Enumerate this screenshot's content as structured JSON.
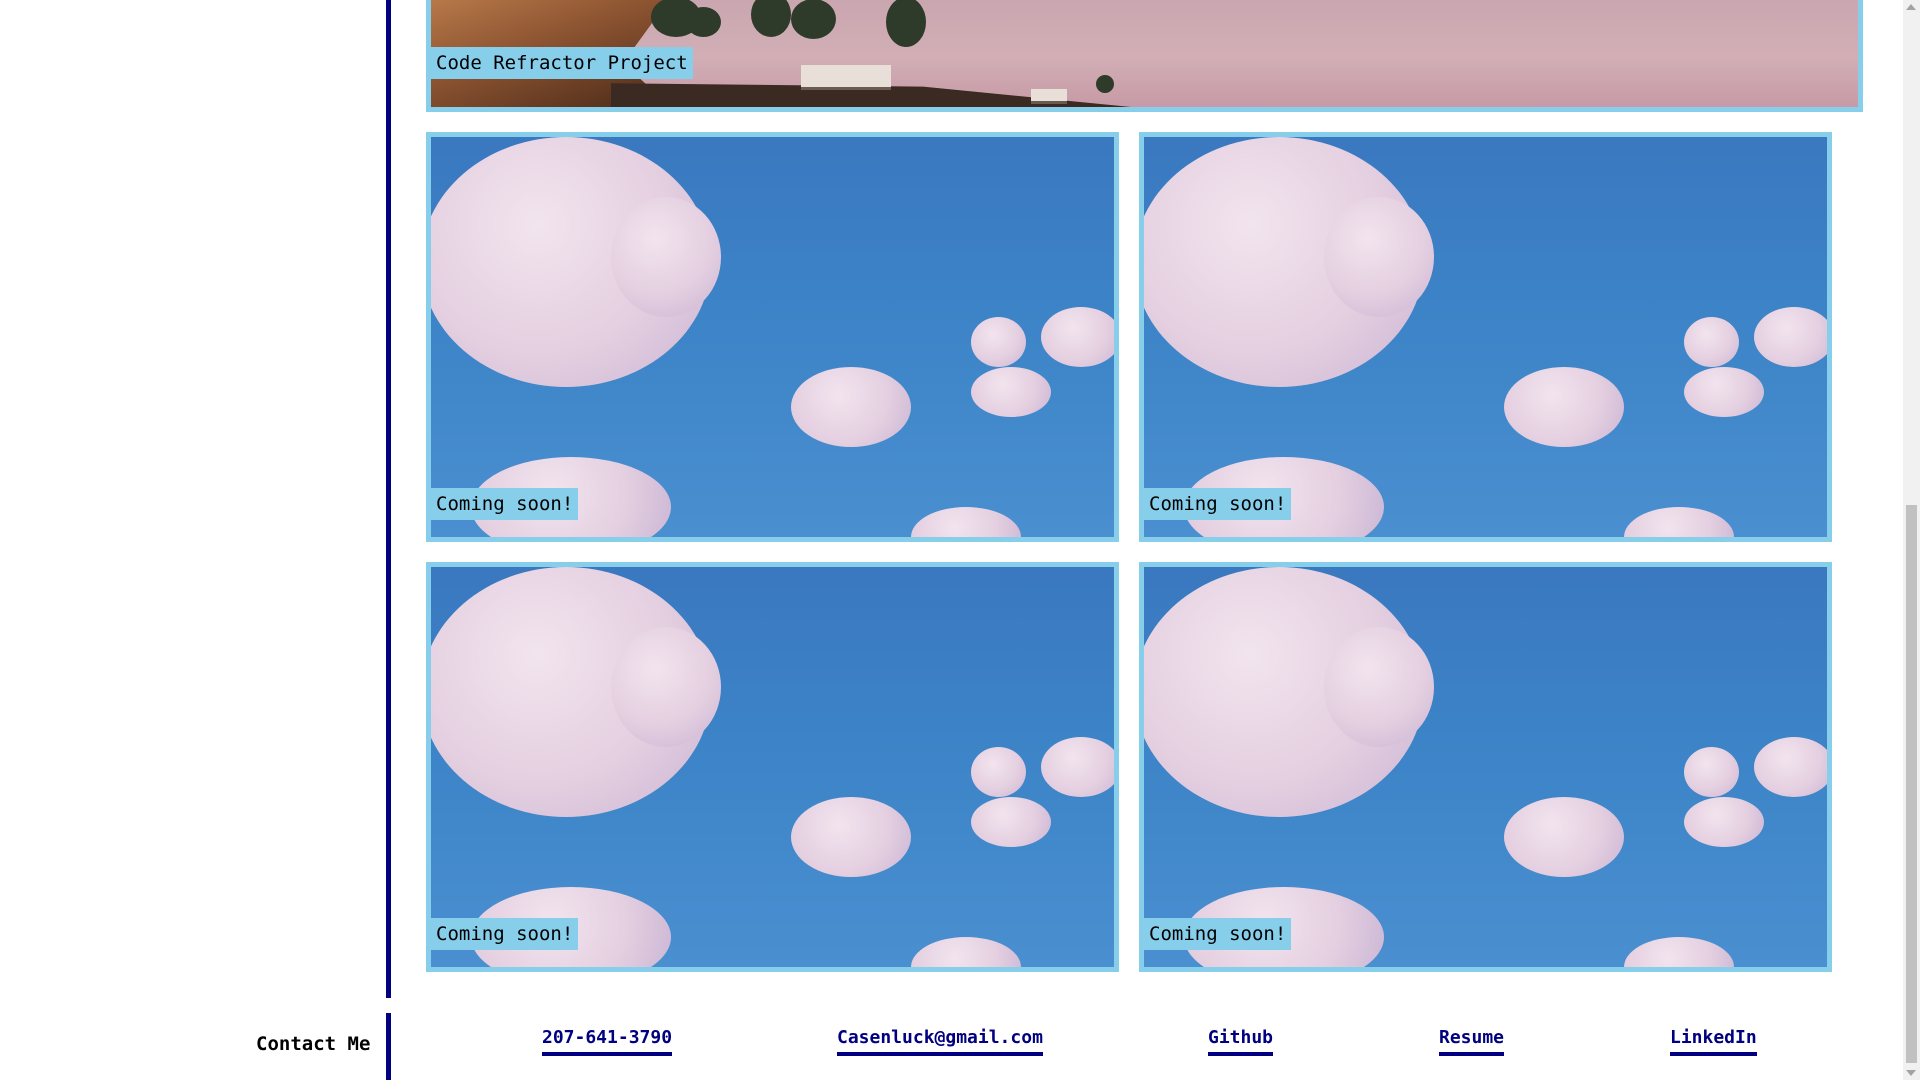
{
  "projects": {
    "featured": {
      "caption": "Code Refractor Project"
    },
    "placeholders": [
      {
        "caption": "Coming soon!"
      },
      {
        "caption": "Coming soon!"
      },
      {
        "caption": "Coming soon!"
      },
      {
        "caption": "Coming soon!"
      }
    ]
  },
  "footer": {
    "label": "Contact Me",
    "links": [
      {
        "label": "207-641-3790"
      },
      {
        "label": "Casenluck@gmail.com"
      },
      {
        "label": "Github"
      },
      {
        "label": "Resume"
      },
      {
        "label": "LinkedIn"
      }
    ]
  },
  "colors": {
    "accent": "#87ceeb",
    "divider": "#000080",
    "link": "#000080"
  }
}
